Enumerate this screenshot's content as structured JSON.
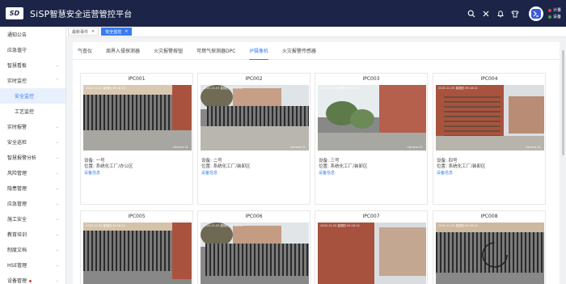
{
  "header": {
    "logo_text": "SD",
    "brand_prefix": "SiSP",
    "title": "智慧安全运营管控平台",
    "avatar_text": "●",
    "icons": [
      "search-icon",
      "expand-icon",
      "bell-icon",
      "shirt-icon"
    ],
    "status": [
      {
        "label": "计量",
        "color": "#e53935"
      },
      {
        "label": "设备",
        "color": "#43a047"
      }
    ]
  },
  "sidebar": {
    "items": [
      {
        "label": "通知公告",
        "chevron": ""
      },
      {
        "label": "应急值守",
        "chevron": ""
      },
      {
        "label": "智慧看板",
        "chevron": "⌄"
      },
      {
        "label": "实时监控",
        "chevron": "⌃"
      },
      {
        "label": "安全监控",
        "chevron": ""
      },
      {
        "label": "工艺监控",
        "chevron": ""
      },
      {
        "label": "实时报警",
        "chevron": "⌄"
      },
      {
        "label": "安全巡检",
        "chevron": "⌄"
      },
      {
        "label": "智慧报警分析",
        "chevron": "⌄"
      },
      {
        "label": "风险管理",
        "chevron": "⌄"
      },
      {
        "label": "隐患管理",
        "chevron": "⌄"
      },
      {
        "label": "应急管理",
        "chevron": "⌄"
      },
      {
        "label": "施工安全",
        "chevron": "⌄"
      },
      {
        "label": "教育培训",
        "chevron": "⌄"
      },
      {
        "label": "制度文档",
        "chevron": "⌄"
      },
      {
        "label": "HSE管理",
        "chevron": "⌄"
      },
      {
        "label": "设备管理",
        "chevron": "⌄"
      }
    ]
  },
  "page_tabs": [
    {
      "label": "最新事件",
      "close": "×"
    },
    {
      "label": "安全监控",
      "close": "×"
    }
  ],
  "category_tabs": [
    "气查仪",
    "周界入侵探测器",
    "火灾报警按钮",
    "可燃气探测器DPC",
    "IP摄像机",
    "火灾报警传感器"
  ],
  "cameras": [
    {
      "title": "IPC001",
      "device": "设备: 一号",
      "location": "位置: 系统化工厂/办公区",
      "link": "设备信息",
      "timestamp": "2020-12-03  星期四  09:16:10",
      "cam_label": "Camera 01"
    },
    {
      "title": "IPC002",
      "device": "设备: 二号",
      "location": "位置: 系统化工厂/装卸区",
      "link": "设备信息",
      "timestamp": "2020-12-03  星期四  09:16:10",
      "cam_label": "Camera 01"
    },
    {
      "title": "IPC003",
      "device": "设备: 三号",
      "location": "位置: 系统化工厂/装卸区",
      "link": "设备信息",
      "timestamp": "2020-12-03  星期四  09:16:10",
      "cam_label": "Camera 01"
    },
    {
      "title": "IPC004",
      "device": "设备: 四号",
      "location": "位置: 系统化工厂/装卸区",
      "link": "设备信息",
      "timestamp": "2020-12-03  星期四  09:16:10",
      "cam_label": "Camera 01"
    },
    {
      "title": "IPC005",
      "device": "",
      "location": "",
      "link": "",
      "timestamp": "2020-12-03  星期四  09:16:10",
      "cam_label": ""
    },
    {
      "title": "IPC006",
      "device": "",
      "location": "",
      "link": "",
      "timestamp": "2020-12-03  星期四  09:16:10",
      "cam_label": ""
    },
    {
      "title": "IPC007",
      "device": "",
      "location": "",
      "link": "",
      "timestamp": "2020-12-03  星期四  09:16:10",
      "cam_label": ""
    },
    {
      "title": "IPC008",
      "device": "",
      "location": "",
      "link": "",
      "timestamp": "2020-12-03  星期四  09:16:10",
      "cam_label": ""
    }
  ]
}
